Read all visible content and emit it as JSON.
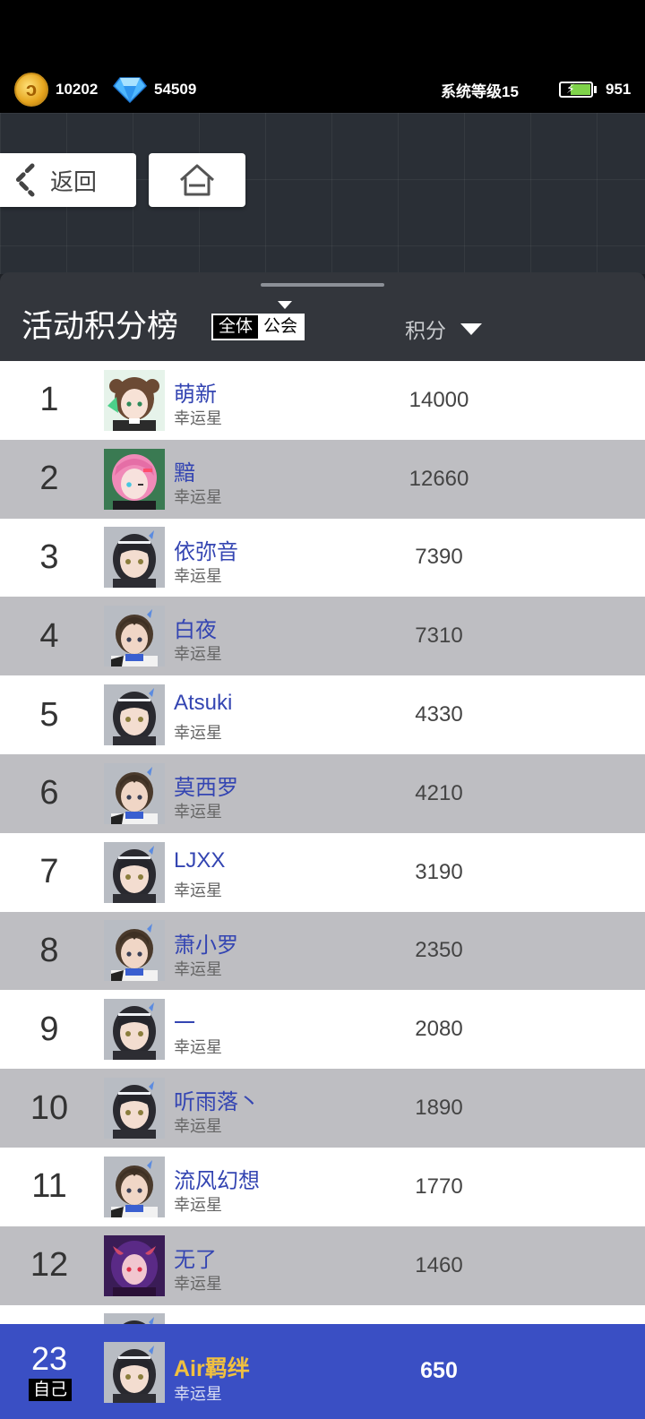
{
  "header": {
    "coins": "10202",
    "gems": "54509",
    "system_level": "系统等级15",
    "energy": "951"
  },
  "nav": {
    "back_label": "返回"
  },
  "panel": {
    "title": "活动积分榜",
    "tabs": [
      {
        "label": "全体",
        "active": true
      },
      {
        "label": "公会",
        "active": false
      }
    ],
    "score_header": "积分"
  },
  "leaderboard": [
    {
      "rank": "1",
      "name": "萌新",
      "title": "幸运星",
      "score": "14000",
      "avatar": "girl-green"
    },
    {
      "rank": "2",
      "name": "黯",
      "title": "幸运星",
      "score": "12660",
      "avatar": "girl-pink"
    },
    {
      "rank": "3",
      "name": "依弥音",
      "title": "幸运星",
      "score": "7390",
      "avatar": "girl-dark"
    },
    {
      "rank": "4",
      "name": "白夜",
      "title": "幸运星",
      "score": "7310",
      "avatar": "boy-brown"
    },
    {
      "rank": "5",
      "name": "Atsuki",
      "title": "幸运星",
      "score": "4330",
      "avatar": "girl-dark"
    },
    {
      "rank": "6",
      "name": "莫西罗",
      "title": "幸运星",
      "score": "4210",
      "avatar": "boy-brown"
    },
    {
      "rank": "7",
      "name": "LJXX",
      "title": "幸运星",
      "score": "3190",
      "avatar": "girl-dark"
    },
    {
      "rank": "8",
      "name": "萧小罗",
      "title": "幸运星",
      "score": "2350",
      "avatar": "boy-brown"
    },
    {
      "rank": "9",
      "name": "一",
      "title": "幸运星",
      "score": "2080",
      "avatar": "girl-dark"
    },
    {
      "rank": "10",
      "name": "听雨落丶",
      "title": "幸运星",
      "score": "1890",
      "avatar": "girl-dark"
    },
    {
      "rank": "11",
      "name": "流风幻想",
      "title": "幸运星",
      "score": "1770",
      "avatar": "boy-brown"
    },
    {
      "rank": "12",
      "name": "无了",
      "title": "幸运星",
      "score": "1460",
      "avatar": "demon-purple"
    },
    {
      "rank": "",
      "name": "",
      "title": "",
      "score": "",
      "avatar": "girl-dark"
    }
  ],
  "self": {
    "rank": "23",
    "tag": "自己",
    "name": "Air羁绊",
    "title": "幸运星",
    "score": "650",
    "avatar": "girl-dark"
  },
  "colors": {
    "name_blue": "#3445b2",
    "self_bar": "#3a4fc4",
    "self_name": "#f0c040",
    "row_alt": "#bebec2"
  }
}
